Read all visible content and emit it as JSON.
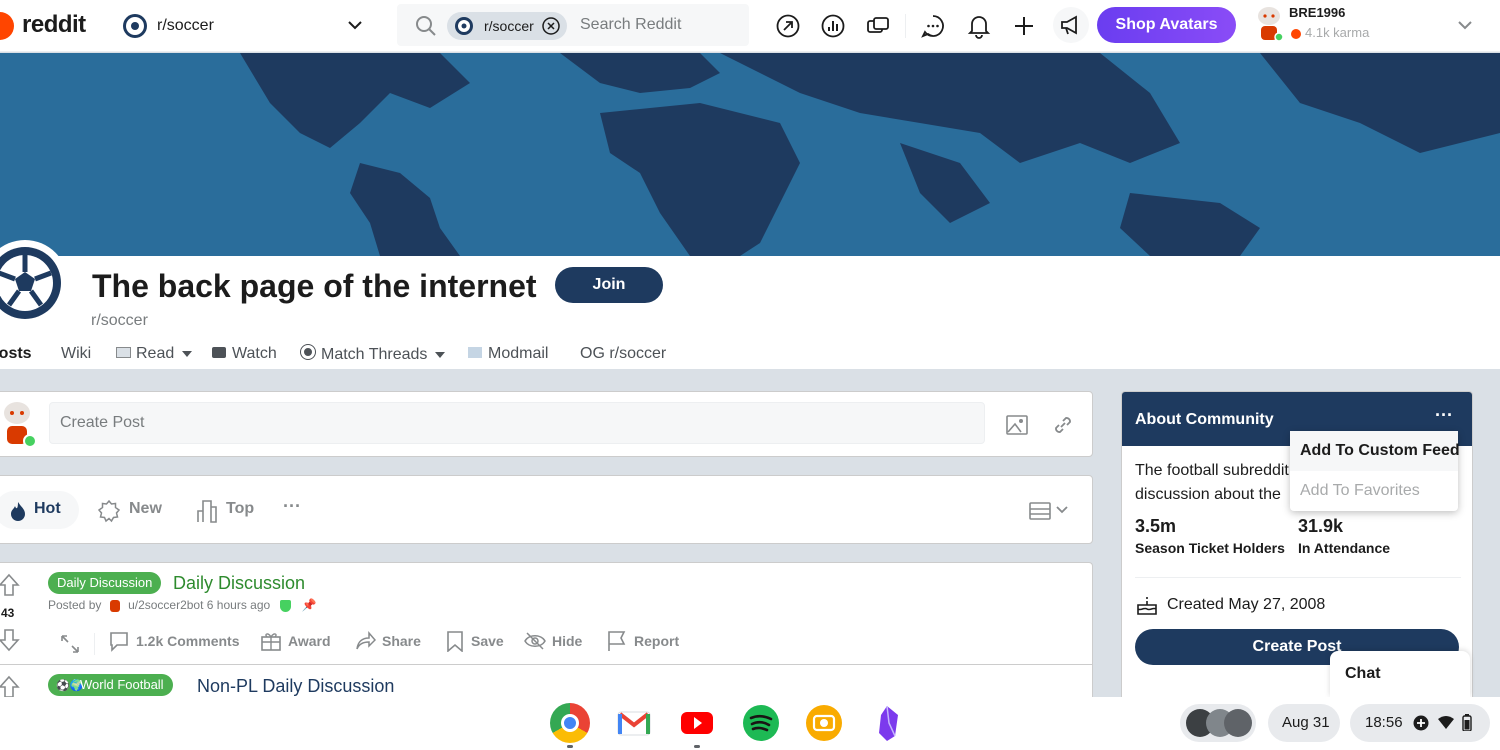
{
  "topnav": {
    "logo_text": "reddit",
    "community_switcher": "r/soccer",
    "search_chip": "r/soccer",
    "search_placeholder": "Search Reddit",
    "shop_button": "Shop Avatars",
    "username": "BRE1996",
    "karma": "4.1k karma"
  },
  "community": {
    "title": "The back page of the internet",
    "join_label": "Join",
    "name": "r/soccer",
    "tabs": [
      {
        "label": "Posts"
      },
      {
        "label": "Wiki"
      },
      {
        "label": "Read"
      },
      {
        "label": "Watch"
      },
      {
        "label": "Match Threads"
      },
      {
        "label": "Modmail"
      },
      {
        "label": "OG r/soccer"
      }
    ]
  },
  "create_post": {
    "placeholder": "Create Post"
  },
  "sort": {
    "hot": "Hot",
    "new": "New",
    "top": "Top",
    "more": "···"
  },
  "posts": [
    {
      "flair": "Daily Discussion",
      "title": "Daily Discussion",
      "votes": "43",
      "meta_prefix": "Posted by",
      "author": "u/2soccer2bot",
      "age": "6 hours ago",
      "actions": {
        "comments": "1.2k Comments",
        "award": "Award",
        "share": "Share",
        "save": "Save",
        "hide": "Hide",
        "report": "Report"
      }
    },
    {
      "flair": "World Football",
      "title": "Non-PL Daily Discussion"
    }
  ],
  "about": {
    "title": "About Community",
    "more": "···",
    "description": "The football subreddit. News, results and discussion about the",
    "stats": [
      {
        "value": "3.5m",
        "label": "Season Ticket Holders"
      },
      {
        "value": "31.9k",
        "label": "In Attendance"
      }
    ],
    "created": "Created May 27, 2008",
    "create_post_label": "Create Post"
  },
  "dropdown": {
    "item1": "Add To Custom Feed",
    "item2": "Add To Favorites"
  },
  "chat": {
    "label": "Chat"
  },
  "shelf": {
    "date": "Aug 31",
    "time": "18:56"
  },
  "colors": {
    "brand": "#ff4500",
    "community_primary": "#1e3a5f",
    "banner": "#1d5f8d",
    "flair": "#4caf50",
    "shop": "#7a44f3"
  },
  "icons": [
    "reddit-logo-icon",
    "soccer-ball-icon",
    "search-icon",
    "chevron-down-icon",
    "popular-icon",
    "all-icon",
    "coins-icon",
    "chat-icon",
    "bell-icon",
    "plus-icon",
    "megaphone-icon",
    "image-icon",
    "link-icon",
    "flame-icon",
    "new-icon",
    "top-icon",
    "card-view-icon",
    "upvote-icon",
    "downvote-icon",
    "expand-icon",
    "comment-icon",
    "gift-icon",
    "share-icon",
    "bookmark-icon",
    "eye-off-icon",
    "flag-icon",
    "cake-icon",
    "chrome-icon",
    "gmail-icon",
    "youtube-icon",
    "spotify-icon",
    "camera-icon",
    "obsidian-icon"
  ]
}
